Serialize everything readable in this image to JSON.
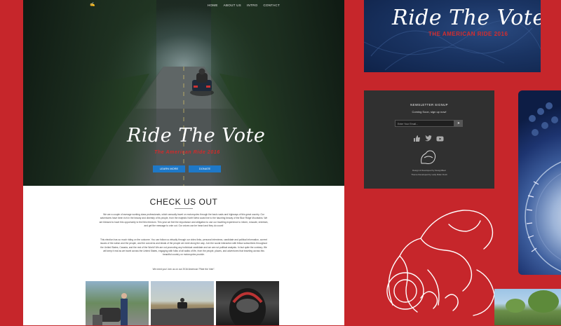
{
  "nav": {
    "items": [
      "HOME",
      "ABOUT US",
      "INTRO",
      "CONTACT"
    ]
  },
  "hero": {
    "title": "Ride The Vote",
    "subtitle": "The American Ride 2016",
    "btn_left": "LEARN MORE",
    "btn_right": "DONATE"
  },
  "section": {
    "title": "CHECK US OUT",
    "para1": "We are a couple of average working class professionals, which annually travel on motorcycles through the back roads and highways of this great country. Our adventures have been rich in the beauty and diversity of its people, from the majestic North West coast line to the haunting beauty of the Blue Ridge Mountains. We are blessed to have this opportunity to feel this freedom. This year we feel the importance and obligation to use our traveling experience to inform, educate, entertain, and get the message to vote out. Our voices can be heard and they do count!",
    "para2": "This election has so much riding on the outcome. You can follow us virtually through our video links, personal interviews, candidate and political information, current issues of the nation and the people, and the concerns and ideals of the people we meet along the way. Join the social interaction with fellow subscribers throughout the United States, Canada, and the rest of the World! We are not promoting any individual candidate and we are not political analysts. In fact quite the contrary. We will keep it real as we travel across the United States, engaging with folks of all walks of life, from the people, places, and adventures that traveling across this beautiful country on motorcycles provide.",
    "para3": "We need you! Join us on our 2016 American \"Ride the Vote\"."
  },
  "banner": {
    "title": "Ride The Vote.Com",
    "subtitle": "THE AMERICAN RIDE 2016"
  },
  "newsletter": {
    "title": "NEWSLETTER SIGNUP",
    "subtitle": "Coming Soon, sign up now!",
    "placeholder": "Enter Your Email...",
    "send_icon": "➤",
    "credit1": "Design & Developed by DesignBear",
    "credit2": "Theme Developed by Lady Rider Duck"
  },
  "colors": {
    "background": "#c6262b",
    "accent_blue": "#1e78c8",
    "accent_red": "#d42a2a"
  }
}
